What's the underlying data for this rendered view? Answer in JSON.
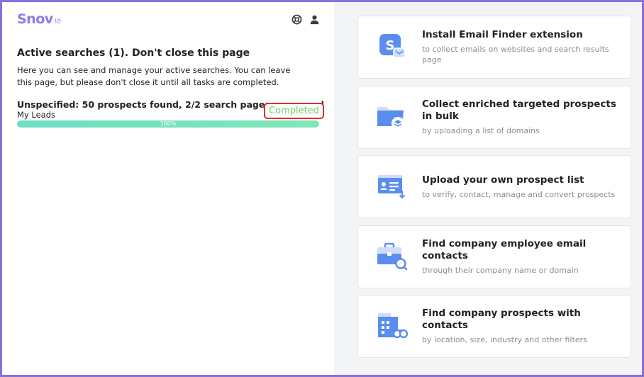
{
  "brand": {
    "name": "Snov",
    "suffix": "io"
  },
  "header": {
    "icons": [
      "support-icon",
      "user-icon"
    ]
  },
  "active": {
    "title": "Active searches (1). Don't close this page",
    "description": "Here you can see and manage your active searches. You can leave this page, but please don't close it until all tasks are completed.",
    "search_title": "Unspecified: 50 prospects found, 2/2 search pages processed",
    "list_name": "My Leads",
    "status": "Completed",
    "progress": 100,
    "progress_label": "100%"
  },
  "colors": {
    "brand": "#8f7be6",
    "accent_blue": "#5b8def",
    "completed_green": "#6ccf6a",
    "highlight_red": "#e02b2b",
    "progress_teal": "#6ddfc2"
  },
  "cards": [
    {
      "icon": "extension-icon",
      "title": "Install Email Finder extension",
      "subtitle": "to collect emails on websites and search results page"
    },
    {
      "icon": "folder-bulk-icon",
      "title": "Collect enriched targeted prospects in bulk",
      "subtitle": "by uploading a list of domains"
    },
    {
      "icon": "upload-list-icon",
      "title": "Upload your own prospect list",
      "subtitle": "to verify, contact, manage and convert prospects"
    },
    {
      "icon": "briefcase-search-icon",
      "title": "Find company employee email contacts",
      "subtitle": "through their company name or domain"
    },
    {
      "icon": "building-binoculars-icon",
      "title": "Find company prospects with contacts",
      "subtitle": "by location, size, industry and other filters"
    }
  ]
}
